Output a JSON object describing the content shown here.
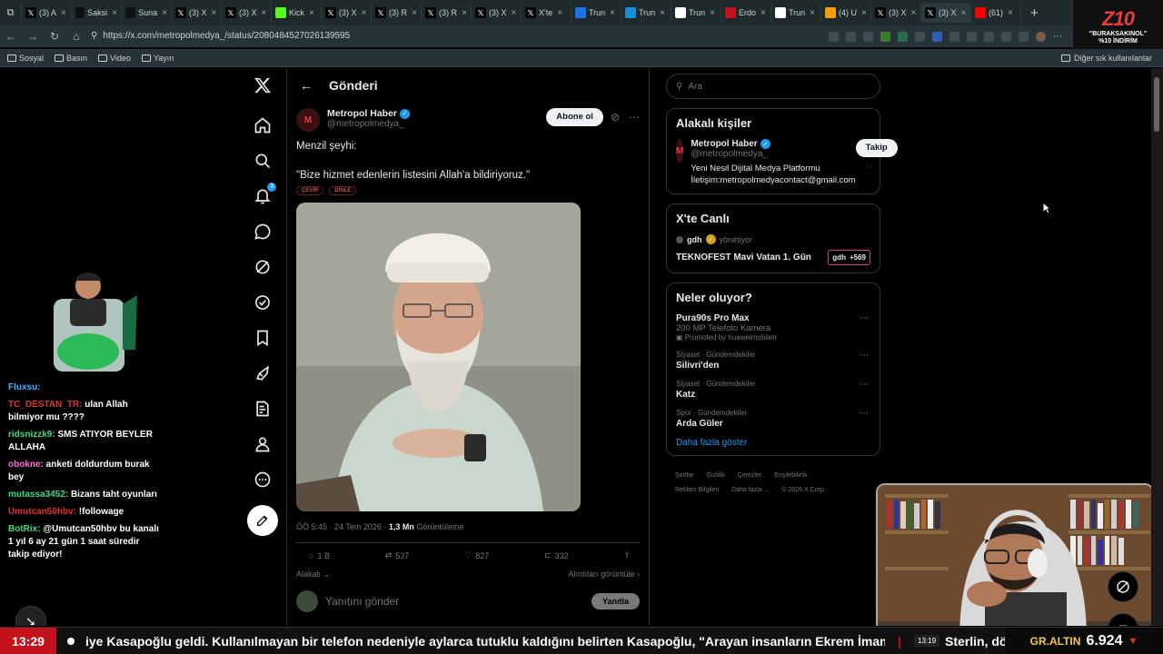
{
  "browser": {
    "tabs": [
      {
        "label": "(3) A",
        "icon": "x-logo-icon",
        "color": "#000000"
      },
      {
        "label": "Saksi",
        "icon": "app-icon",
        "color": "#111111"
      },
      {
        "label": "Suna",
        "icon": "app-icon",
        "color": "#111111"
      },
      {
        "label": "(3) X",
        "icon": "x-logo-icon",
        "color": "#000000"
      },
      {
        "label": "(3) X",
        "icon": "x-logo-icon",
        "color": "#000000"
      },
      {
        "label": "Kick",
        "icon": "kick-icon",
        "color": "#53fc18"
      },
      {
        "label": "(3) X",
        "icon": "x-logo-icon",
        "color": "#000000"
      },
      {
        "label": "(3) R",
        "icon": "x-logo-icon",
        "color": "#000000"
      },
      {
        "label": "(3) R",
        "icon": "x-logo-icon",
        "color": "#000000"
      },
      {
        "label": "(3) X",
        "icon": "x-logo-icon",
        "color": "#000000"
      },
      {
        "label": "X'te",
        "icon": "x-logo-icon",
        "color": "#000000"
      },
      {
        "label": "Trun",
        "icon": "news-icon",
        "color": "#1a73e8"
      },
      {
        "label": "Trun",
        "icon": "circle-icon",
        "color": "#1a8cd8"
      },
      {
        "label": "Trun",
        "icon": "news-icon",
        "color": "#ffffff"
      },
      {
        "label": "Erdo",
        "icon": "b-icon",
        "color": "#c4121d"
      },
      {
        "label": "Trun",
        "icon": "news-icon",
        "color": "#ffffff"
      },
      {
        "label": "(4) U",
        "icon": "app-icon",
        "color": "#f59e0b"
      },
      {
        "label": "(3) X",
        "icon": "x-logo-icon",
        "color": "#000000"
      },
      {
        "label": "(3) X",
        "icon": "x-logo-icon",
        "color": "#000000"
      },
      {
        "label": "(61)",
        "icon": "youtube-icon",
        "color": "#ff0000"
      }
    ],
    "new_tab": "+",
    "url": "https://x.com/metropolmedya_/status/2080484527026139595",
    "bookmarks": [
      "Sosyal",
      "Basın",
      "Video",
      "Yayın"
    ],
    "other_bookmarks": "Diğer sık kullanılanlar",
    "promo": {
      "logo": "Z10",
      "line1": "\"BURAKSAKINOL\"",
      "line2": "%10 İNDİRİM"
    }
  },
  "nav": {
    "notifications_badge": "3"
  },
  "post": {
    "header_title": "Gönderi",
    "author_name": "Metropol Haber",
    "author_handle": "@metropolmedya_",
    "avatar_letter": "M",
    "subscribe_label": "Abone ol",
    "line1": "Menzil şeyhi:",
    "line2": "\"Bize hizmet edenlerin listesini Allah'a bildiriyoruz.\"",
    "chip_translate": "ÇEVİR",
    "chip_listen": "DİNLE",
    "time": "ÖÖ 5:45 · 24 Tem 2026 ·",
    "views_count": "1,3 Mn",
    "views_label": "Görüntüleme",
    "replies": "1 B",
    "reposts": "537",
    "likes": "827",
    "bookmarks": "332",
    "related_label": "Alakalı",
    "quotes_label": "Alıntıları görüntüle",
    "reply_placeholder": "Yanıtını gönder",
    "reply_button": "Yanıtla"
  },
  "sidebar": {
    "search_placeholder": "Ara",
    "related_title": "Alakalı kişiler",
    "person_name": "Metropol Haber",
    "person_handle": "@metropolmedya_",
    "person_bio": "Yeni Nesil Dijital Medya Platformu İletişim:metropolmedyacontact@gmail.com",
    "follow_label": "Takip et",
    "live_title": "X'te Canlı",
    "live_host": "gdh",
    "live_role": "yönetiyor",
    "live_event": "TEKNOFEST Mavi Vatan 1. Gün",
    "live_count_host": "gdh",
    "live_count": "+569",
    "trends_title": "Neler oluyor?",
    "trends": [
      {
        "ctx": "",
        "topic": "Pura90s Pro Max",
        "sub": "200 MP Telefoto Kamera",
        "promo": "Promoted by huaweimobiletr"
      },
      {
        "ctx": "Siyaset · Gündemdekiler",
        "topic": "Silivri'den",
        "sub": "",
        "promo": ""
      },
      {
        "ctx": "Siyaset · Gündemdekiler",
        "topic": "Katz",
        "sub": "",
        "promo": ""
      },
      {
        "ctx": "Spor · Gündemdekiler",
        "topic": "Arda Güler",
        "sub": "",
        "promo": ""
      }
    ],
    "show_more": "Daha fazla göster",
    "footer": [
      "Şartlar",
      "Gizlilik",
      "Çerezler",
      "Erişilebilirlik",
      "Reklam Bilgileri",
      "Daha fazla ...",
      "© 2026 X Corp."
    ]
  },
  "chat": [
    {
      "user": "Fluxsu:",
      "msg": "",
      "color": "#3db2ff"
    },
    {
      "user": "TC_DESTAN_TR:",
      "msg": "ulan Allah bilmiyor mu ????",
      "color": "#e0312f"
    },
    {
      "user": "ridsnizzk9:",
      "msg": "SMS ATIYOR BEYLER ALLAHA",
      "color": "#3ddc84"
    },
    {
      "user": "obokne:",
      "msg": "anketi doldurdum burak bey",
      "color": "#ff6fd8"
    },
    {
      "user": "mutassa3452:",
      "msg": "Bizans taht oyunları",
      "color": "#3ddc84"
    },
    {
      "user": "Umutcan50hbv:",
      "msg": "!followage",
      "color": "#e0312f"
    },
    {
      "user": "BotRix:",
      "msg": "@Umutcan50hbv bu kanalı 1 yıl 6 ay 21 gün 1 saat süredir takip ediyor!",
      "color": "#3ddc84"
    }
  ],
  "ticker": {
    "time": "13:29",
    "text": "iye Kasapoğlu geldi. Kullanılmayan bir telefon nedeniyle aylarca tutuklu kaldığını belirten Kasapoğlu, \"Arayan insanların Ekrem İmamoğl",
    "small_time": "13:19",
    "text2": "Sterlin, dö",
    "gold_label": "GR.ALTIN",
    "gold_value": "6.924",
    "gold_arrow": "▼"
  }
}
